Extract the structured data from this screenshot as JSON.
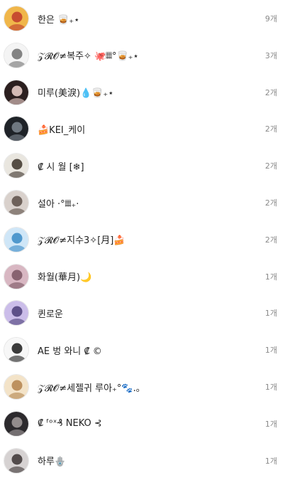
{
  "rows": [
    {
      "name": "한은 🥃₊⋆",
      "count": "9개",
      "avatar_bg": "#f0b64a",
      "avatar_fg": "#c0392b",
      "avatar_icon": "pikachu-avatar-icon"
    },
    {
      "name": "𝒵𝓡𝓞≠복주✧ 🐙𝄜°🥃₊⋆",
      "count": "3개",
      "avatar_bg": "#f4f4f4",
      "avatar_fg": "#6f6f6f",
      "avatar_icon": "chef-avatar-icon"
    },
    {
      "name": "미루(美淚)💧🥃₊⋆",
      "count": "2개",
      "avatar_bg": "#2b1f1f",
      "avatar_fg": "#f1d6d0",
      "avatar_icon": "portrait-avatar-icon"
    },
    {
      "name": "🍰KEI_케이",
      "count": "2개",
      "avatar_bg": "#1f2328",
      "avatar_fg": "#7e8791",
      "avatar_icon": "portrait-avatar-icon"
    },
    {
      "name": "₡ 시 월 [❄]",
      "count": "2개",
      "avatar_bg": "#e9e6df",
      "avatar_fg": "#3b3129",
      "avatar_icon": "portrait-avatar-icon"
    },
    {
      "name": "설아 ·°𝄜₊·",
      "count": "2개",
      "avatar_bg": "#d9d1cc",
      "avatar_fg": "#5a4d45",
      "avatar_icon": "portrait-avatar-icon"
    },
    {
      "name": "𝒵𝓡𝓞≠지수3✧[月]🍰",
      "count": "2개",
      "avatar_bg": "#cfe6f7",
      "avatar_fg": "#3a8ac6",
      "avatar_icon": "blue-character-avatar-icon"
    },
    {
      "name": "화월(華月)🌙",
      "count": "1개",
      "avatar_bg": "#d8b7c2",
      "avatar_fg": "#7a5561",
      "avatar_icon": "portrait-avatar-icon"
    },
    {
      "name": "퀸로운",
      "count": "1개",
      "avatar_bg": "#cbbde9",
      "avatar_fg": "#4b3d78",
      "avatar_icon": "portrait-avatar-icon"
    },
    {
      "name": "AE 벙 와니 ₡ ©",
      "count": "1개",
      "avatar_bg": "#f7f7f7",
      "avatar_fg": "#1a1a1a",
      "avatar_icon": "mask-avatar-icon"
    },
    {
      "name": "𝒵𝓡𝓞≠세젤귀 루아₊°🐾.。",
      "count": "1개",
      "avatar_bg": "#f3e3c8",
      "avatar_fg": "#b3834c",
      "avatar_icon": "portrait-avatar-icon"
    },
    {
      "name": "₡ ᶠᵒˣ₰ NEKO ⊰",
      "count": "1개",
      "avatar_bg": "#2c2a2d",
      "avatar_fg": "#a59e9e",
      "avatar_icon": "portrait-avatar-icon"
    },
    {
      "name": "하루🪬",
      "count": "1개",
      "avatar_bg": "#d6d2d2",
      "avatar_fg": "#3b3434",
      "avatar_icon": "portrait-avatar-icon"
    }
  ]
}
